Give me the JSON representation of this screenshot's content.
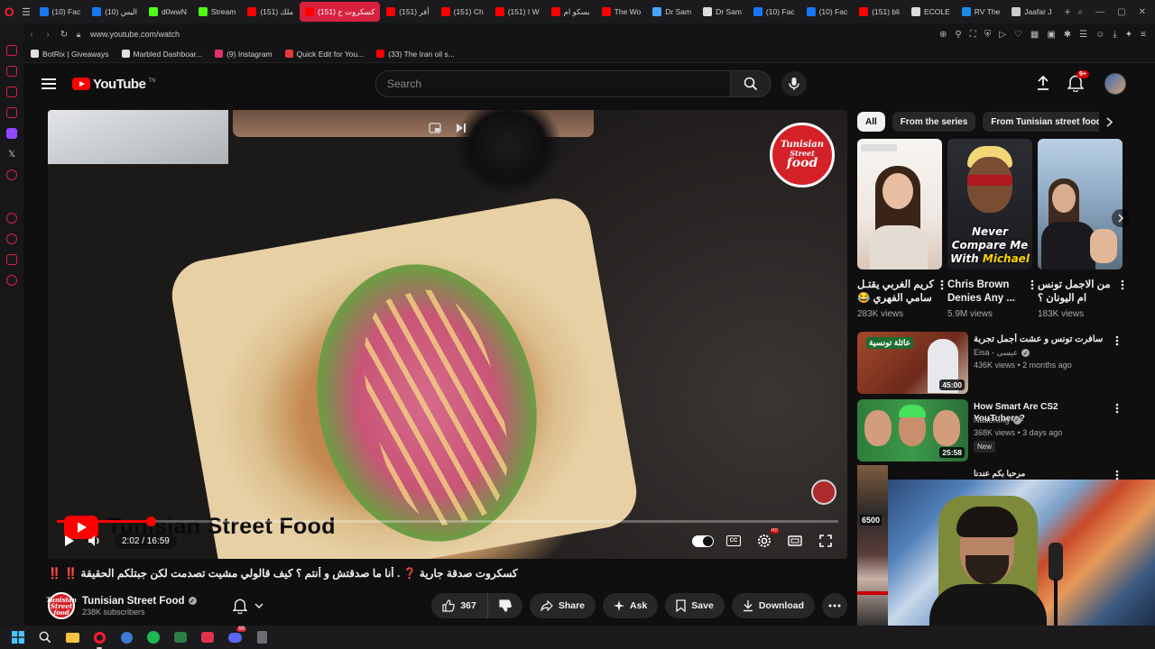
{
  "browser": {
    "tabs": [
      {
        "label": "(10) Fac",
        "color": "#1877f2"
      },
      {
        "label": "(10) اليس",
        "color": "#1877f2"
      },
      {
        "label": "d0wwN",
        "color": "#53fc18"
      },
      {
        "label": "Stream",
        "color": "#53fc18"
      },
      {
        "label": "(151) ملك",
        "color": "#ff0000"
      },
      {
        "label": "(151) كسكروت ج",
        "color": "#ff0000",
        "active": true
      },
      {
        "label": "(151) أفر",
        "color": "#ff0000"
      },
      {
        "label": "(151) Ch",
        "color": "#ff0000"
      },
      {
        "label": "(151) I W",
        "color": "#ff0000"
      },
      {
        "label": "بسكو ام",
        "color": "#ff0000"
      },
      {
        "label": "The Wo",
        "color": "#ff0000"
      },
      {
        "label": "Dr Sam",
        "color": "#4aa3ff"
      },
      {
        "label": "Dr Sam",
        "color": "#dddddd"
      },
      {
        "label": "(10) Fac",
        "color": "#1877f2"
      },
      {
        "label": "(10) Fac",
        "color": "#1877f2"
      },
      {
        "label": "(151) bli",
        "color": "#ff0000"
      },
      {
        "label": "ECOLE",
        "color": "#dddddd"
      },
      {
        "label": "RV The",
        "color": "#1e88e5"
      },
      {
        "label": "Jaafar J",
        "color": "#cccccc"
      }
    ],
    "new_tab": "+",
    "url": "www.youtube.com/watch",
    "bookmarks": [
      {
        "label": "BotRix | Giveaways",
        "color": "#e0e0e0"
      },
      {
        "label": "Marbled Dashboar...",
        "color": "#e0e0e0"
      },
      {
        "label": "(9) Instagram",
        "color": "#e1306c"
      },
      {
        "label": "Quick Edit for You...",
        "color": "#e53935"
      },
      {
        "label": "(33) The Iran oil s...",
        "color": "#ff0000"
      }
    ]
  },
  "youtube": {
    "logo_text": "YouTube",
    "logo_region": "TN",
    "search_placeholder": "Search",
    "notif_count": "9+",
    "player": {
      "overlay_title": "Tunisian Street Food",
      "logo_lines": [
        "Tunisian",
        "Street",
        "food"
      ],
      "time": "2:02 / 16:59",
      "progress_fraction": 0.12,
      "cc": "CC",
      "hd": "HD"
    },
    "video": {
      "title": "كسكروت صدقة جارية ❓ . أنا ما صدقتش و أنتم ؟ كيف قالولي مشيت تصدمت لكن جبتلكم الحقيقة ‼️ ‼️",
      "channel": "Tunisian Street Food",
      "subscribers": "238K subscribers",
      "avatar_text": "Tunisian Street food",
      "likes": "367",
      "share": "Share",
      "ask": "Ask",
      "save": "Save",
      "download": "Download"
    },
    "chips": [
      {
        "label": "All",
        "active": true
      },
      {
        "label": "From the series"
      },
      {
        "label": "From Tunisian street food"
      }
    ],
    "shorts": [
      {
        "title": "كريم الغربي يقتـل سامي الفهري 😂",
        "views": "283K views"
      },
      {
        "title": "Chris Brown Denies Any ...",
        "views": "5.9M views",
        "cap1": "Never Compare Me",
        "cap2": "With ",
        "cap3": "Michael"
      },
      {
        "title": "من الاجمل تونس ام اليونان ؟",
        "views": "183K views"
      }
    ],
    "recommended": [
      {
        "title": "سافرت تونس و عشت أجمل تجربة",
        "channel": "Eisa - عيسى",
        "meta": "436K views • 2 months ago",
        "duration": "45:00",
        "thumb_text": "عائلة تونسية"
      },
      {
        "title": "How Smart Are CS2 YouTubers?",
        "channel": "NadeKing",
        "meta": "368K views • 3 days ago",
        "duration": "25:58",
        "badge": "New"
      },
      {
        "title": "مرحبا بكم عندنا"
      }
    ],
    "lower_badge": "6500"
  }
}
